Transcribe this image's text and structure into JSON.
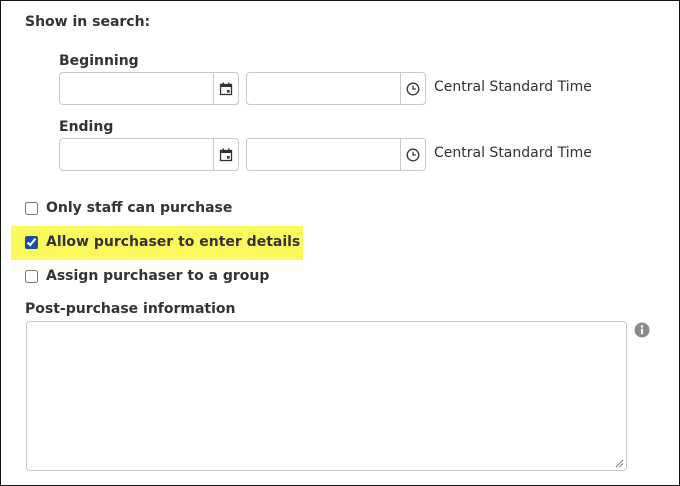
{
  "show_in_search": {
    "label": "Show in search:",
    "beginning": {
      "label": "Beginning",
      "date_value": "",
      "time_value": "",
      "timezone": "Central Standard Time"
    },
    "ending": {
      "label": "Ending",
      "date_value": "",
      "time_value": "",
      "timezone": "Central Standard Time"
    }
  },
  "options": {
    "only_staff": {
      "label": "Only staff can purchase",
      "checked": false
    },
    "allow_details": {
      "label": "Allow purchaser to enter details",
      "checked": true
    },
    "assign_group": {
      "label": "Assign purchaser to a group",
      "checked": false
    }
  },
  "post_purchase": {
    "label": "Post-purchase information",
    "value": ""
  },
  "colors": {
    "highlight": "#fbf85c",
    "checkbox_accent": "#1a4fa0",
    "border": "#c8c8c8"
  },
  "icons": {
    "date": "calendar-icon",
    "time": "clock-icon",
    "info": "info-icon"
  }
}
